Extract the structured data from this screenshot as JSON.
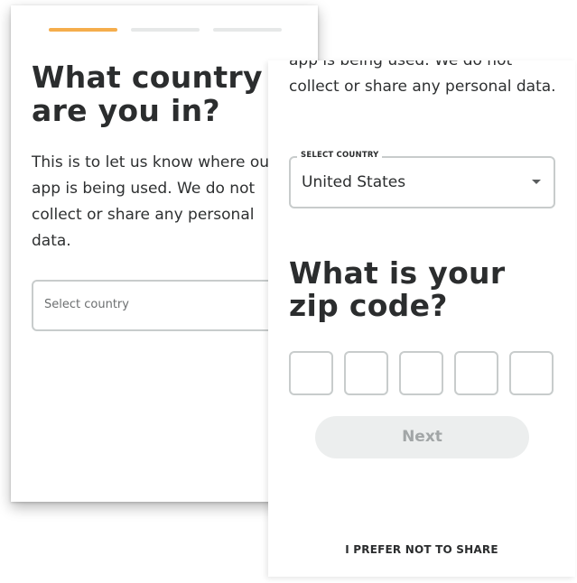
{
  "screen_country": {
    "progress": [
      {
        "state": "active"
      },
      {
        "state": "inactive"
      },
      {
        "state": "inactive"
      }
    ],
    "title": "What country are you in?",
    "description": "This is to let us know where our app is being used. We do not collect or share any personal data.",
    "select_placeholder": "Select country"
  },
  "screen_zip": {
    "description_tail": "app is being used. We do not collect or share any personal data.",
    "country_select": {
      "label": "SELECT COUNTRY",
      "value": "United States"
    },
    "title": "What is your zip code?",
    "zip_digits": [
      "",
      "",
      "",
      "",
      ""
    ],
    "next_label": "Next",
    "prefer_not_label": "I PREFER NOT TO SHARE"
  },
  "colors": {
    "accent": "#f5ad4c",
    "border": "#c8cccc",
    "button_disabled_bg": "#eceeee",
    "button_disabled_text": "#a2a6a7"
  }
}
